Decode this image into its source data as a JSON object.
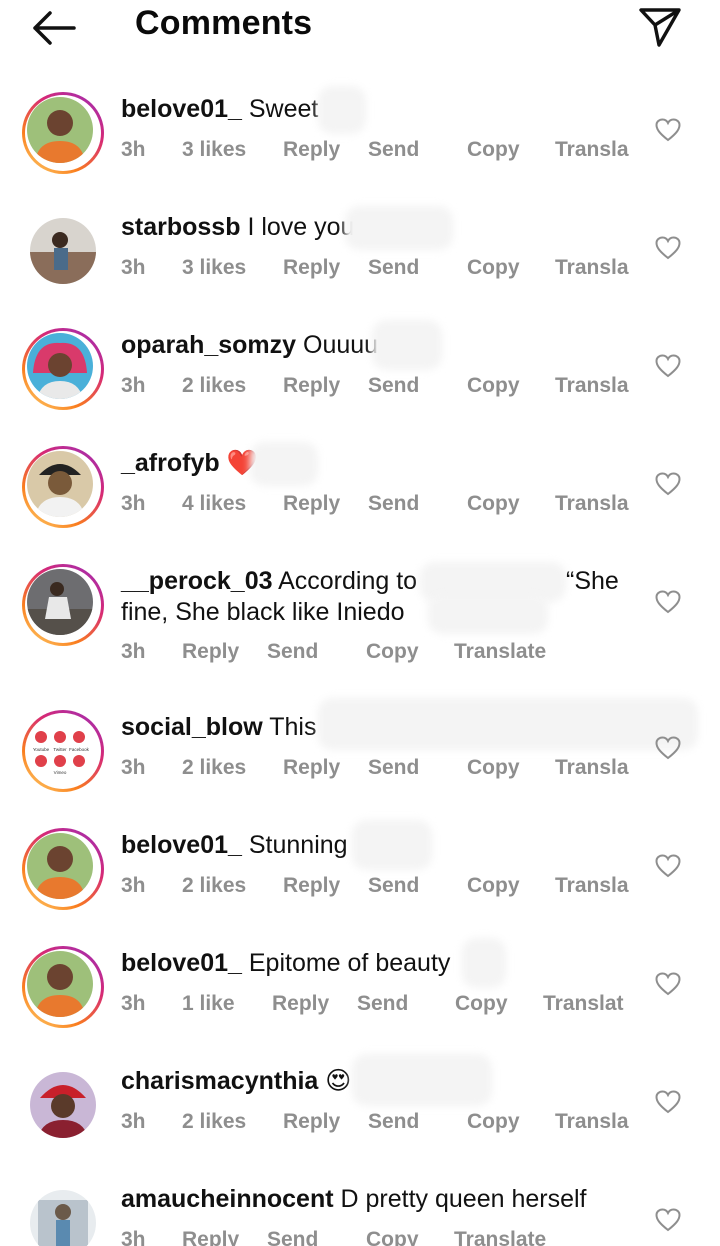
{
  "header": {
    "title": "Comments",
    "back_icon": "arrow-left-icon",
    "share_icon": "paper-plane-icon"
  },
  "actions": {
    "reply": "Reply",
    "send": "Send",
    "copy": "Copy"
  },
  "comments": [
    {
      "username": "belove01_",
      "text": "Sweet",
      "time": "3h",
      "likes": "3 likes",
      "translate": "Transla",
      "ring": true,
      "avatar_color": "#e8792e"
    },
    {
      "username": "starbossb",
      "text": "I love you",
      "time": "3h",
      "likes": "3 likes",
      "translate": "Transla",
      "ring": false,
      "avatar_color": "#8a6d5a"
    },
    {
      "username": "oparah_somzy",
      "text": "Ouuuu",
      "time": "3h",
      "likes": "2 likes",
      "translate": "Transla",
      "ring": true,
      "avatar_color": "#d93a6b"
    },
    {
      "username": "_afrofyb",
      "text": "❤️",
      "time": "3h",
      "likes": "4 likes",
      "translate": "Transla",
      "ring": true,
      "avatar_color": "#7a5a3a"
    },
    {
      "username": "__perock_03",
      "text": "According to",
      "text_extra": "“She",
      "text_line2": "fine, She black like Iniedo",
      "time": "3h",
      "translate": "Translate",
      "ring": true,
      "avatar_color": "#6d6d70"
    },
    {
      "username": "social_blow",
      "text": "This",
      "time": "3h",
      "likes": "2 likes",
      "translate": "Transla",
      "ring": true,
      "avatar_color": "#ffffff",
      "social_labels": [
        "Youtube",
        "Twitter",
        "Facebook",
        "Vimeo"
      ]
    },
    {
      "username": "belove01_",
      "text": "Stunning",
      "time": "3h",
      "likes": "2 likes",
      "translate": "Transla",
      "ring": true,
      "avatar_color": "#e8792e"
    },
    {
      "username": "belove01_",
      "text": "Epitome of beauty",
      "time": "3h",
      "likes": "1 like",
      "translate": "Translat",
      "ring": true,
      "avatar_color": "#e8792e"
    },
    {
      "username": "charismacynthia",
      "text": "😍",
      "time": "3h",
      "likes": "2 likes",
      "translate": "Transla",
      "ring": false,
      "avatar_color": "#8a2030"
    },
    {
      "username": "amaucheinnocent",
      "text": "D pretty queen herself",
      "time": "3h",
      "translate": "Translate",
      "ring": false,
      "avatar_color": "#b9c3cc"
    }
  ],
  "colors": {
    "meta_gray": "#8e8e8e",
    "ring_start": "#feda75",
    "ring_end": "#962fbf"
  }
}
